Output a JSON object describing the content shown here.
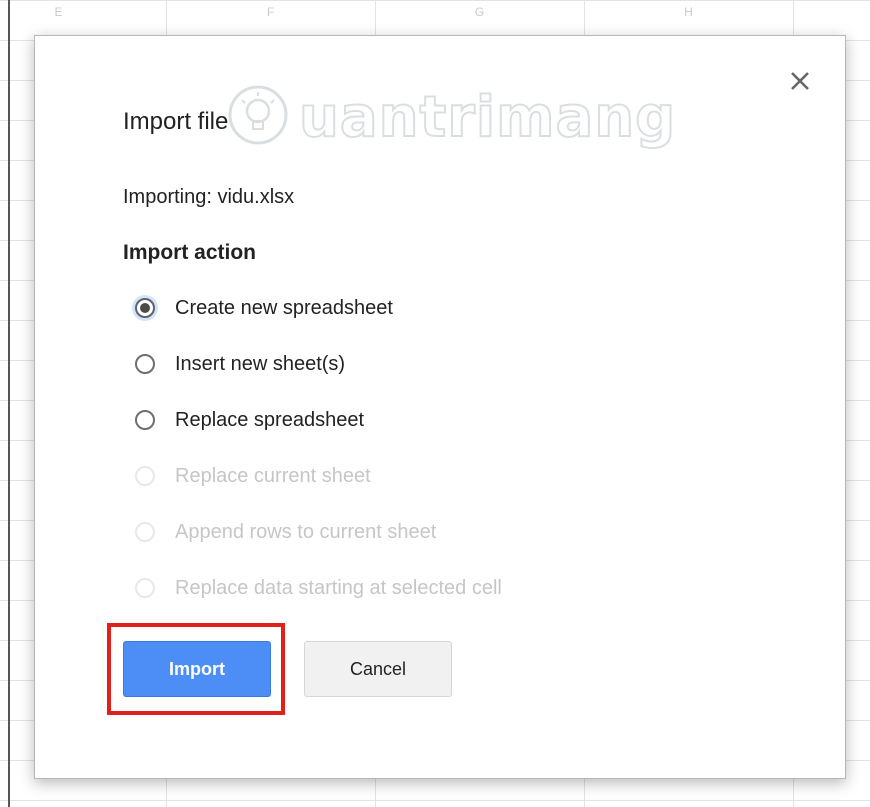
{
  "spreadsheet": {
    "columns": [
      "E",
      "F",
      "G",
      "H"
    ]
  },
  "dialog": {
    "title": "Import file",
    "importing_text": "Importing: vidu.xlsx",
    "section_title": "Import action",
    "options": [
      {
        "label": "Create new spreadsheet",
        "selected": true,
        "enabled": true
      },
      {
        "label": "Insert new sheet(s)",
        "selected": false,
        "enabled": true
      },
      {
        "label": "Replace spreadsheet",
        "selected": false,
        "enabled": true
      },
      {
        "label": "Replace current sheet",
        "selected": false,
        "enabled": false
      },
      {
        "label": "Append rows to current sheet",
        "selected": false,
        "enabled": false
      },
      {
        "label": "Replace data starting at selected cell",
        "selected": false,
        "enabled": false
      }
    ],
    "import_button": "Import",
    "cancel_button": "Cancel",
    "close_icon": "close-icon"
  },
  "watermark": {
    "text": "uantrimang",
    "icon": "lightbulb-logo-icon"
  },
  "colors": {
    "primary_button": "#4d8ef6",
    "highlight": "#e0201b",
    "disabled_text": "#c6c6c6"
  }
}
